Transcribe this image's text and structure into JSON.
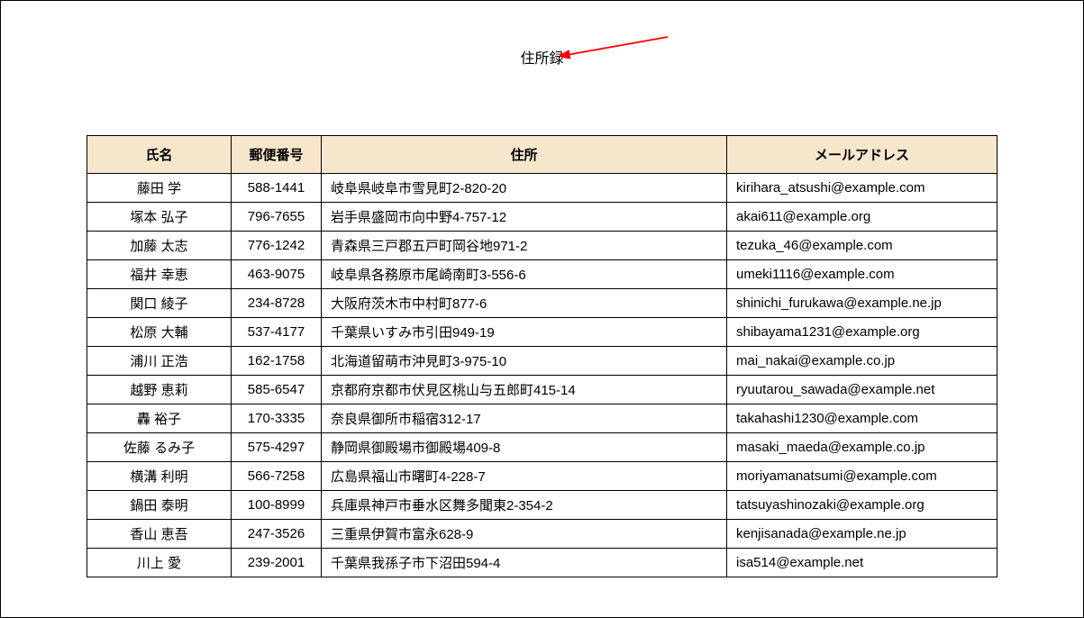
{
  "title": "住所録",
  "headers": {
    "name": "氏名",
    "zip": "郵便番号",
    "addr": "住所",
    "email": "メールアドレス"
  },
  "rows": [
    {
      "name": "藤田 学",
      "zip": "588-1441",
      "addr": "岐阜県岐阜市雪見町2-820-20",
      "email": "kirihara_atsushi@example.com"
    },
    {
      "name": "塚本 弘子",
      "zip": "796-7655",
      "addr": "岩手県盛岡市向中野4-757-12",
      "email": "akai611@example.org"
    },
    {
      "name": "加藤 太志",
      "zip": "776-1242",
      "addr": "青森県三戸郡五戸町岡谷地971-2",
      "email": "tezuka_46@example.com"
    },
    {
      "name": "福井 幸恵",
      "zip": "463-9075",
      "addr": "岐阜県各務原市尾崎南町3-556-6",
      "email": "umeki1116@example.com"
    },
    {
      "name": "関口 綾子",
      "zip": "234-8728",
      "addr": "大阪府茨木市中村町877-6",
      "email": "shinichi_furukawa@example.ne.jp"
    },
    {
      "name": "松原 大輔",
      "zip": "537-4177",
      "addr": "千葉県いすみ市引田949-19",
      "email": "shibayama1231@example.org"
    },
    {
      "name": "浦川 正浩",
      "zip": "162-1758",
      "addr": "北海道留萌市沖見町3-975-10",
      "email": "mai_nakai@example.co.jp"
    },
    {
      "name": "越野 恵莉",
      "zip": "585-6547",
      "addr": "京都府京都市伏見区桃山与五郎町415-14",
      "email": "ryuutarou_sawada@example.net"
    },
    {
      "name": "轟 裕子",
      "zip": "170-3335",
      "addr": "奈良県御所市稲宿312-17",
      "email": "takahashi1230@example.com"
    },
    {
      "name": "佐藤 るみ子",
      "zip": "575-4297",
      "addr": "静岡県御殿場市御殿場409-8",
      "email": "masaki_maeda@example.co.jp"
    },
    {
      "name": "横溝 利明",
      "zip": "566-7258",
      "addr": "広島県福山市曙町4-228-7",
      "email": "moriyamanatsumi@example.com"
    },
    {
      "name": "鍋田 泰明",
      "zip": "100-8999",
      "addr": "兵庫県神戸市垂水区舞多聞東2-354-2",
      "email": "tatsuyashinozaki@example.org"
    },
    {
      "name": "香山 恵吾",
      "zip": "247-3526",
      "addr": "三重県伊賀市富永628-9",
      "email": "kenjisanada@example.ne.jp"
    },
    {
      "name": "川上 愛",
      "zip": "239-2001",
      "addr": "千葉県我孫子市下沼田594-4",
      "email": "isa514@example.net"
    }
  ]
}
